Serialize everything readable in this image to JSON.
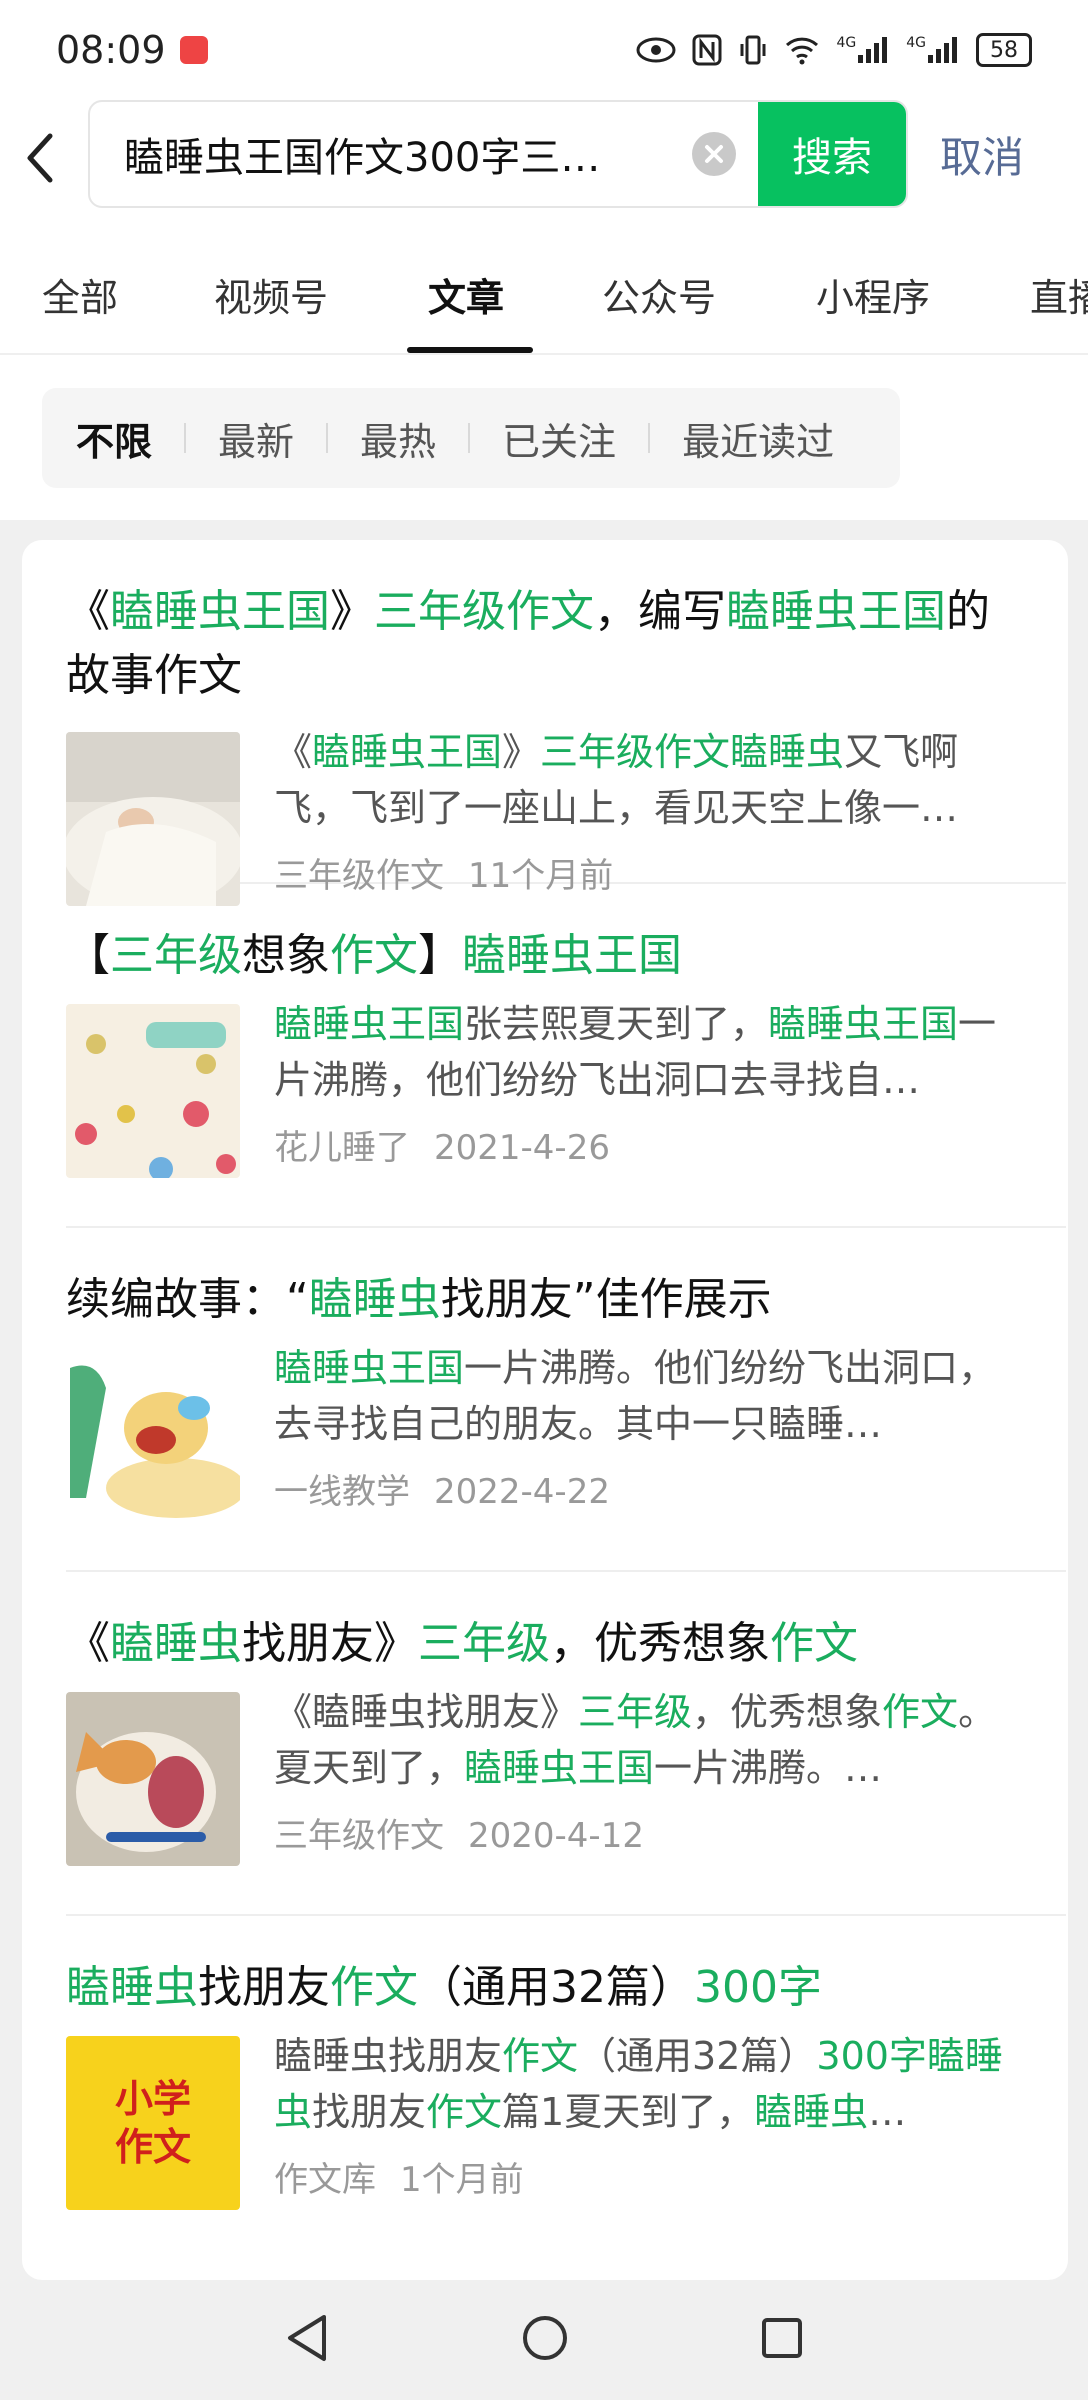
{
  "status_bar": {
    "time": "08:09",
    "net1": "4G",
    "net2": "4G",
    "battery": "58"
  },
  "search": {
    "query": "瞌睡虫王国作文300字三…",
    "button_label": "搜索",
    "cancel_label": "取消"
  },
  "tabs": [
    {
      "label": "全部"
    },
    {
      "label": "视频号"
    },
    {
      "label": "文章"
    },
    {
      "label": "公众号"
    },
    {
      "label": "小程序"
    },
    {
      "label": "直播"
    }
  ],
  "active_tab": "文章",
  "filters": [
    {
      "label": "不限"
    },
    {
      "label": "最新"
    },
    {
      "label": "最热"
    },
    {
      "label": "已关注"
    },
    {
      "label": "最近读过"
    }
  ],
  "active_filter": "不限",
  "results": [
    {
      "title_parts": [
        {
          "text": "《",
          "hl": false
        },
        {
          "text": "瞌睡虫王国",
          "hl": true
        },
        {
          "text": "》",
          "hl": false
        },
        {
          "text": "三年级作文",
          "hl": true
        },
        {
          "text": "，编写",
          "hl": false
        },
        {
          "text": "瞌睡虫王国",
          "hl": true
        },
        {
          "text": "的故事作文",
          "hl": false
        }
      ],
      "snippet_parts": [
        {
          "text": "《",
          "hl": false
        },
        {
          "text": "瞌睡虫王国",
          "hl": true
        },
        {
          "text": "》",
          "hl": false
        },
        {
          "text": "三年级作文瞌睡虫",
          "hl": true
        },
        {
          "text": "又飞啊飞，飞到了一座山上，看见天空上像一…",
          "hl": false
        }
      ],
      "source": "三年级作文",
      "time": "11个月前",
      "thumb": "sleeping-child-photo"
    },
    {
      "title_parts": [
        {
          "text": "【",
          "hl": false
        },
        {
          "text": "三年级",
          "hl": true
        },
        {
          "text": "想象",
          "hl": false
        },
        {
          "text": "作文",
          "hl": true
        },
        {
          "text": "】",
          "hl": false
        },
        {
          "text": "瞌睡虫王国",
          "hl": true
        }
      ],
      "snippet_parts": [
        {
          "text": "瞌睡虫王国",
          "hl": true
        },
        {
          "text": "张芸熙夏天到了，",
          "hl": false
        },
        {
          "text": "瞌睡虫王国",
          "hl": true
        },
        {
          "text": "一片沸腾，他们纷纷飞出洞口去寻找自…",
          "hl": false
        }
      ],
      "source": "花儿睡了",
      "time": "2021-4-26",
      "thumb": "flowers-bees-pattern"
    },
    {
      "title_parts": [
        {
          "text": "续编故事：“",
          "hl": false
        },
        {
          "text": "瞌睡虫",
          "hl": true
        },
        {
          "text": "找朋友”佳作展示",
          "hl": false
        }
      ],
      "snippet_parts": [
        {
          "text": "瞌睡虫王国",
          "hl": true
        },
        {
          "text": "一片沸腾。他们纷纷飞出洞口，去寻找自己的朋友。其中一只瞌睡…",
          "hl": false
        }
      ],
      "source": "一线教学",
      "time": "2022-4-22",
      "thumb": "yawning-cartoon-duck"
    },
    {
      "title_parts": [
        {
          "text": "《",
          "hl": false
        },
        {
          "text": "瞌睡虫",
          "hl": true
        },
        {
          "text": "找朋友》",
          "hl": false
        },
        {
          "text": "三年级",
          "hl": true
        },
        {
          "text": "，优秀想象",
          "hl": false
        },
        {
          "text": "作文",
          "hl": true
        }
      ],
      "snippet_parts": [
        {
          "text": "《瞌睡虫找朋友》",
          "hl": false
        },
        {
          "text": "三年级",
          "hl": true
        },
        {
          "text": "，优秀想象",
          "hl": false
        },
        {
          "text": "作文",
          "hl": true
        },
        {
          "text": "。夏天到了，",
          "hl": false
        },
        {
          "text": "瞌睡虫王国",
          "hl": true
        },
        {
          "text": "一片沸腾。…",
          "hl": false
        }
      ],
      "source": "三年级作文",
      "time": "2020-4-12",
      "thumb": "yawning-cat-photo"
    },
    {
      "title_parts": [
        {
          "text": "瞌睡虫",
          "hl": true
        },
        {
          "text": "找朋友",
          "hl": false
        },
        {
          "text": "作文",
          "hl": true
        },
        {
          "text": "（通用32篇）",
          "hl": false
        },
        {
          "text": "300字",
          "hl": true
        }
      ],
      "snippet_parts": [
        {
          "text": "瞌睡虫找朋友",
          "hl": false
        },
        {
          "text": "作文",
          "hl": true
        },
        {
          "text": "（通用32篇）",
          "hl": false
        },
        {
          "text": "300字瞌睡虫",
          "hl": true
        },
        {
          "text": "找朋友",
          "hl": false
        },
        {
          "text": "作文",
          "hl": true
        },
        {
          "text": "篇1夏天到了，",
          "hl": false
        },
        {
          "text": "瞌睡虫",
          "hl": true
        },
        {
          "text": "…",
          "hl": false
        }
      ],
      "source": "作文库",
      "time": "1个月前",
      "thumb": "primary-school-essay-logo",
      "thumb_text_1": "小学",
      "thumb_text_2": "作文"
    }
  ],
  "colors": {
    "highlight": "#1aad5e",
    "search_button": "#07c160",
    "cancel_link": "#576b95"
  }
}
